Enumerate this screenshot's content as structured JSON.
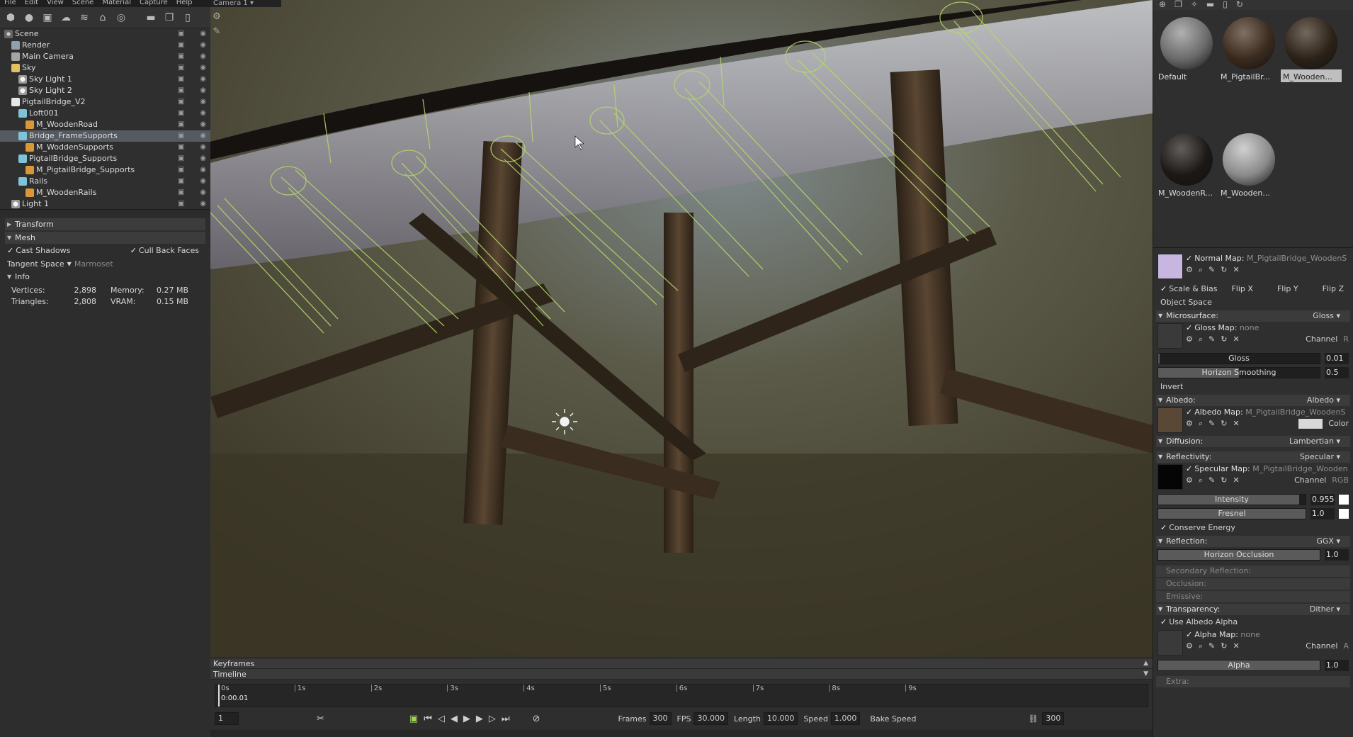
{
  "menu": [
    "File",
    "Edit",
    "View",
    "Scene",
    "Material",
    "Capture",
    "Help"
  ],
  "viewport_tab": "Camera 1",
  "scene_tree": [
    {
      "label": "Scene",
      "icon": "scene",
      "depth": 0,
      "selected": false
    },
    {
      "label": "Render",
      "icon": "render",
      "depth": 1,
      "selected": false
    },
    {
      "label": "Main Camera",
      "icon": "camera",
      "depth": 1,
      "selected": false
    },
    {
      "label": "Sky",
      "icon": "sky",
      "depth": 1,
      "selected": false
    },
    {
      "label": "Sky Light 1",
      "icon": "light",
      "depth": 2,
      "selected": false
    },
    {
      "label": "Sky Light 2",
      "icon": "light",
      "depth": 2,
      "selected": false
    },
    {
      "label": "PigtailBridge_V2",
      "icon": "group",
      "depth": 1,
      "selected": false
    },
    {
      "label": "Loft001",
      "icon": "mesh",
      "depth": 2,
      "selected": false
    },
    {
      "label": "M_WoodenRoad",
      "icon": "material",
      "depth": 3,
      "selected": false
    },
    {
      "label": "Bridge_FrameSupports",
      "icon": "mesh",
      "depth": 2,
      "selected": true
    },
    {
      "label": "M_WoddenSupports",
      "icon": "material",
      "depth": 3,
      "selected": false
    },
    {
      "label": "PigtailBridge_Supports",
      "icon": "mesh",
      "depth": 2,
      "selected": false
    },
    {
      "label": "M_PigtailBridge_Supports",
      "icon": "material",
      "depth": 3,
      "selected": false
    },
    {
      "label": "Rails",
      "icon": "mesh",
      "depth": 2,
      "selected": false
    },
    {
      "label": "M_WoodenRails",
      "icon": "material",
      "depth": 3,
      "selected": false
    },
    {
      "label": "Light 1",
      "icon": "light",
      "depth": 1,
      "selected": false
    }
  ],
  "props": {
    "transform_label": "Transform",
    "mesh_label": "Mesh",
    "cast_shadows": "Cast Shadows",
    "cull_back_faces": "Cull Back Faces",
    "tangent_space_label": "Tangent Space",
    "tangent_space_value": "Marmoset",
    "info_label": "Info",
    "vertices_label": "Vertices:",
    "vertices_value": "2,898",
    "memory_label": "Memory:",
    "memory_value": "0.27 MB",
    "triangles_label": "Triangles:",
    "triangles_value": "2,808",
    "vram_label": "VRAM:",
    "vram_value": "0.15 MB"
  },
  "timeline": {
    "keyframes_label": "Keyframes",
    "timeline_label": "Timeline",
    "ticks": [
      "0s",
      "1s",
      "2s",
      "3s",
      "4s",
      "5s",
      "6s",
      "7s",
      "8s",
      "9s"
    ],
    "current_time": "0:00.01",
    "frame": "1",
    "frames_label": "Frames",
    "frames_value": "300",
    "fps_label": "FPS",
    "fps_value": "30.000",
    "length_label": "Length",
    "length_value": "10.000",
    "speed_label": "Speed",
    "speed_value": "1.000",
    "bake_speed": "Bake Speed",
    "end_frame": "300"
  },
  "materials": [
    {
      "name": "Default",
      "color": "#6a6a6a",
      "selected": false
    },
    {
      "name": "M_PigtailBr...",
      "color": "#3a2a1e",
      "selected": false
    },
    {
      "name": "M_Wooden...",
      "color": "#2c2218",
      "selected": true
    },
    {
      "name": "M_WoodenR...",
      "color": "#1c1816",
      "selected": false
    },
    {
      "name": "M_Wooden...",
      "color": "#8a8a8a",
      "selected": false
    }
  ],
  "editor": {
    "normal_map_label": "Normal Map:",
    "normal_map_value": "M_PigtailBridge_WoodenS",
    "scale_bias": "Scale & Bias",
    "flip_x": "Flip X",
    "flip_y": "Flip Y",
    "flip_z": "Flip Z",
    "object_space": "Object Space",
    "microsurface_label": "Microsurface:",
    "microsurface_value": "Gloss",
    "gloss_map_label": "Gloss Map:",
    "gloss_map_value": "none",
    "channel_label": "Channel",
    "gloss_channel": "R",
    "gloss_label": "Gloss",
    "gloss_value": "0.01",
    "gloss_fill": 0.01,
    "horizon_smoothing_label": "Horizon Smoothing",
    "horizon_smoothing_value": "0.5",
    "horizon_smoothing_fill": 0.5,
    "invert_label": "Invert",
    "albedo_label": "Albedo:",
    "albedo_value": "Albedo",
    "albedo_map_label": "Albedo Map:",
    "albedo_map_value": "M_PigtailBridge_WoodenS",
    "color_label": "Color",
    "diffusion_label": "Diffusion:",
    "diffusion_value": "Lambertian",
    "reflectivity_label": "Reflectivity:",
    "reflectivity_value": "Specular",
    "specular_map_label": "Specular Map:",
    "specular_map_value": "M_PigtailBridge_Wooden",
    "specular_channel": "RGB",
    "intensity_label": "Intensity",
    "intensity_value": "0.955",
    "intensity_fill": 0.955,
    "fresnel_label": "Fresnel",
    "fresnel_value": "1.0",
    "fresnel_fill": 1.0,
    "conserve_energy": "Conserve Energy",
    "reflection_label": "Reflection:",
    "reflection_value": "GGX",
    "horizon_occlusion_label": "Horizon Occlusion",
    "horizon_occlusion_value": "1.0",
    "horizon_occlusion_fill": 1.0,
    "secondary_reflection": "Secondary Reflection:",
    "occlusion": "Occlusion:",
    "emissive": "Emissive:",
    "transparency_label": "Transparency:",
    "transparency_value": "Dither",
    "use_albedo_alpha": "Use Albedo Alpha",
    "alpha_map_label": "Alpha Map:",
    "alpha_map_value": "none",
    "alpha_channel": "A",
    "alpha_label": "Alpha",
    "alpha_value": "1.0",
    "alpha_fill": 1.0,
    "extra": "Extra:"
  },
  "colors": {
    "selection": "#555a60",
    "wireframe": "#b5d86a",
    "panel": "#2f2f2f"
  }
}
